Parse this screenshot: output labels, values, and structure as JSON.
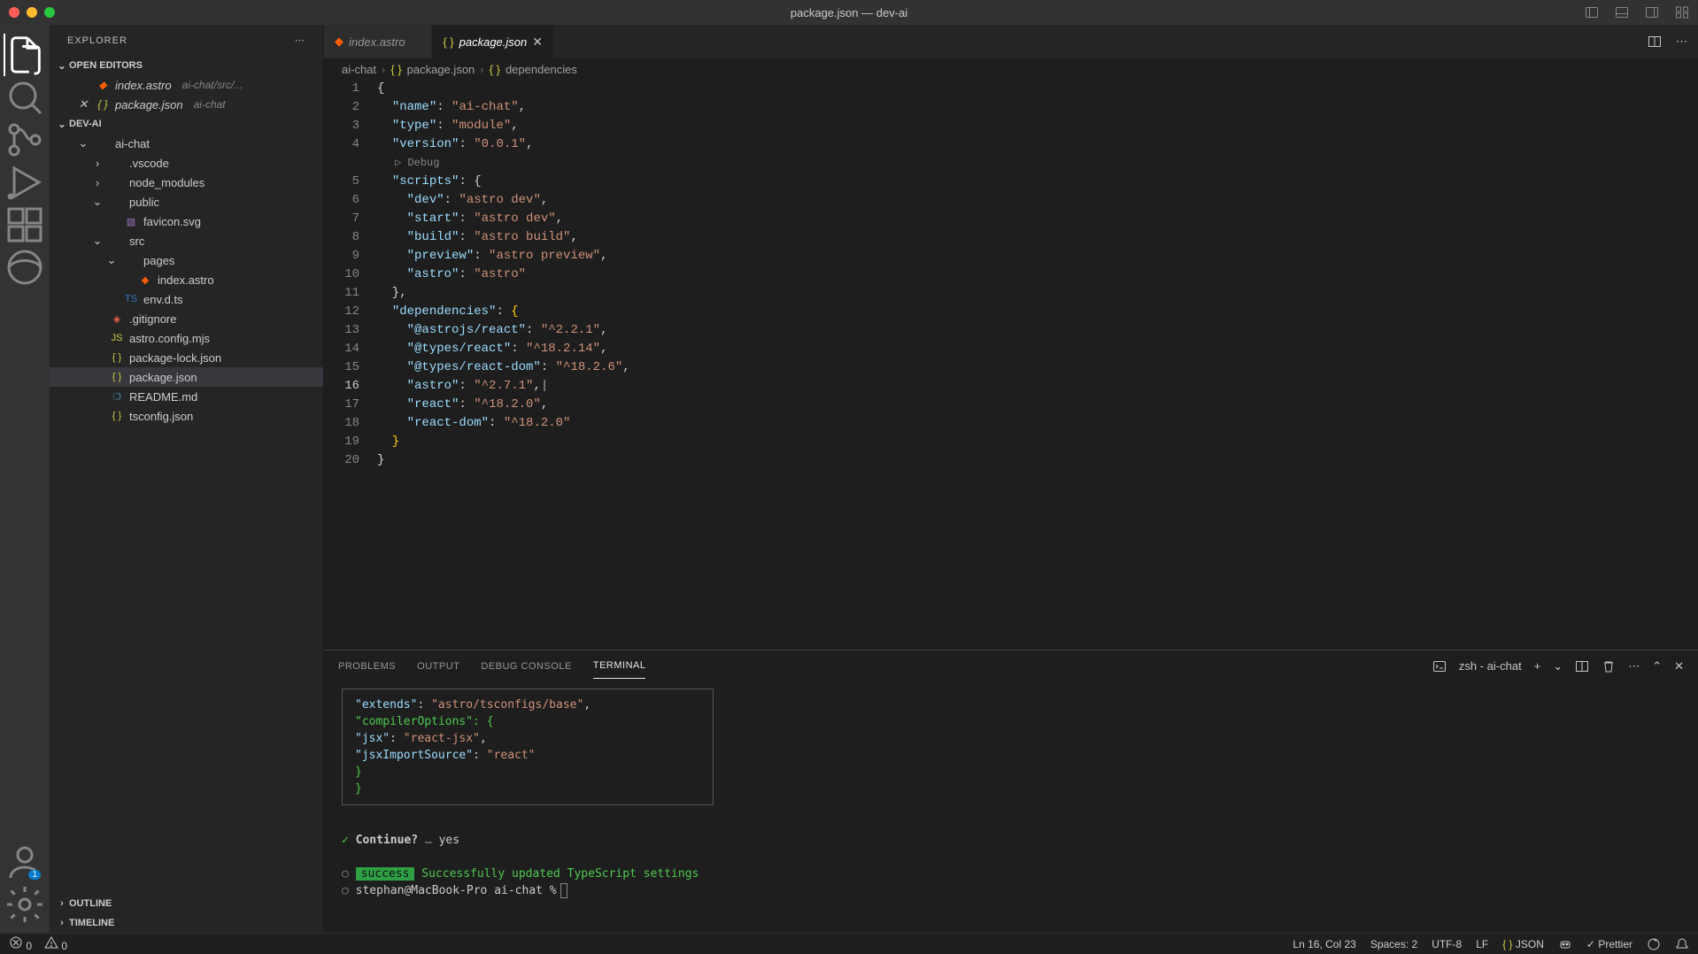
{
  "window": {
    "title": "package.json — dev-ai"
  },
  "sidebar": {
    "title": "EXPLORER",
    "sections": {
      "openEditors": "OPEN EDITORS",
      "project": "DEV-AI",
      "outline": "OUTLINE",
      "timeline": "TIMELINE"
    },
    "openEditors": [
      {
        "name": "index.astro",
        "meta": "ai-chat/src/...",
        "italic": true
      },
      {
        "name": "package.json",
        "meta": "ai-chat",
        "italic": true,
        "closable": true
      }
    ],
    "tree": [
      {
        "name": "ai-chat",
        "type": "folder",
        "depth": 1,
        "open": true
      },
      {
        "name": ".vscode",
        "type": "folder",
        "depth": 2
      },
      {
        "name": "node_modules",
        "type": "folder",
        "depth": 2
      },
      {
        "name": "public",
        "type": "folder",
        "depth": 2,
        "open": true
      },
      {
        "name": "favicon.svg",
        "type": "svg",
        "depth": 3
      },
      {
        "name": "src",
        "type": "folder",
        "depth": 2,
        "open": true
      },
      {
        "name": "pages",
        "type": "folder",
        "depth": 3,
        "open": true
      },
      {
        "name": "index.astro",
        "type": "astro",
        "depth": 4
      },
      {
        "name": "env.d.ts",
        "type": "ts",
        "depth": 3
      },
      {
        "name": ".gitignore",
        "type": "git",
        "depth": 2
      },
      {
        "name": "astro.config.mjs",
        "type": "js",
        "depth": 2
      },
      {
        "name": "package-lock.json",
        "type": "json",
        "depth": 2
      },
      {
        "name": "package.json",
        "type": "json",
        "depth": 2,
        "active": true
      },
      {
        "name": "README.md",
        "type": "md",
        "depth": 2
      },
      {
        "name": "tsconfig.json",
        "type": "json",
        "depth": 2
      }
    ]
  },
  "tabs": [
    {
      "label": "index.astro",
      "type": "astro",
      "italic": true
    },
    {
      "label": "package.json",
      "type": "json",
      "italic": true,
      "active": true
    }
  ],
  "breadcrumb": [
    "ai-chat",
    "package.json",
    "dependencies"
  ],
  "code": {
    "debugHint": "Debug",
    "lines": [
      {
        "n": 1,
        "t": "{"
      },
      {
        "n": 2,
        "k": "name",
        "v": "ai-chat",
        "comma": true
      },
      {
        "n": 3,
        "k": "type",
        "v": "module",
        "comma": true
      },
      {
        "n": 4,
        "k": "version",
        "v": "0.0.1",
        "comma": true
      },
      {
        "n": 5,
        "k": "scripts",
        "open": true
      },
      {
        "n": 6,
        "k": "dev",
        "v": "astro dev",
        "comma": true,
        "indent": 2
      },
      {
        "n": 7,
        "k": "start",
        "v": "astro dev",
        "comma": true,
        "indent": 2
      },
      {
        "n": 8,
        "k": "build",
        "v": "astro build",
        "comma": true,
        "indent": 2
      },
      {
        "n": 9,
        "k": "preview",
        "v": "astro preview",
        "comma": true,
        "indent": 2
      },
      {
        "n": 10,
        "k": "astro",
        "v": "astro",
        "indent": 2
      },
      {
        "n": 11,
        "t": "  },",
        "close": true
      },
      {
        "n": 12,
        "k": "dependencies",
        "open": true,
        "highlight": true
      },
      {
        "n": 13,
        "k": "@astrojs/react",
        "v": "^2.2.1",
        "comma": true,
        "indent": 2
      },
      {
        "n": 14,
        "k": "@types/react",
        "v": "^18.2.14",
        "comma": true,
        "indent": 2
      },
      {
        "n": 15,
        "k": "@types/react-dom",
        "v": "^18.2.6",
        "comma": true,
        "indent": 2
      },
      {
        "n": 16,
        "k": "astro",
        "v": "^2.7.1",
        "comma": true,
        "indent": 2,
        "active": true
      },
      {
        "n": 17,
        "k": "react",
        "v": "^18.2.0",
        "comma": true,
        "indent": 2
      },
      {
        "n": 18,
        "k": "react-dom",
        "v": "^18.2.0",
        "indent": 2
      },
      {
        "n": 19,
        "t": "  }",
        "close": true,
        "highlight": true
      },
      {
        "n": 20,
        "t": "}"
      }
    ]
  },
  "panel": {
    "tabs": [
      "PROBLEMS",
      "OUTPUT",
      "DEBUG CONSOLE",
      "TERMINAL"
    ],
    "activeTab": 3,
    "terminalLabel": "zsh - ai-chat",
    "box": [
      {
        "k": "extends",
        "v": "astro/tsconfigs/base",
        "comma": true
      },
      {
        "k": "compilerOptions",
        "open": true
      },
      {
        "k": "jsx",
        "v": "react-jsx",
        "comma": true,
        "indent": 1
      },
      {
        "k": "jsxImportSource",
        "v": "react",
        "indent": 1
      },
      {
        "close": "}",
        "indent": 0
      },
      {
        "close": "}",
        "outdent": true
      }
    ],
    "continueLine": {
      "check": "✓",
      "prompt": "Continue?",
      "ellipsis": "…",
      "answer": "yes"
    },
    "successLine": {
      "badge": "success",
      "msg": "Successfully updated TypeScript settings"
    },
    "promptLine": {
      "user": "stephan@MacBook-Pro",
      "cwd": "ai-chat",
      "sym": "%"
    }
  },
  "statusbar": {
    "errors": "0",
    "warnings": "0",
    "cursor": "Ln 16, Col 23",
    "spaces": "Spaces: 2",
    "encoding": "UTF-8",
    "eol": "LF",
    "lang": "JSON",
    "formatter": "Prettier"
  },
  "accountBadge": "1"
}
